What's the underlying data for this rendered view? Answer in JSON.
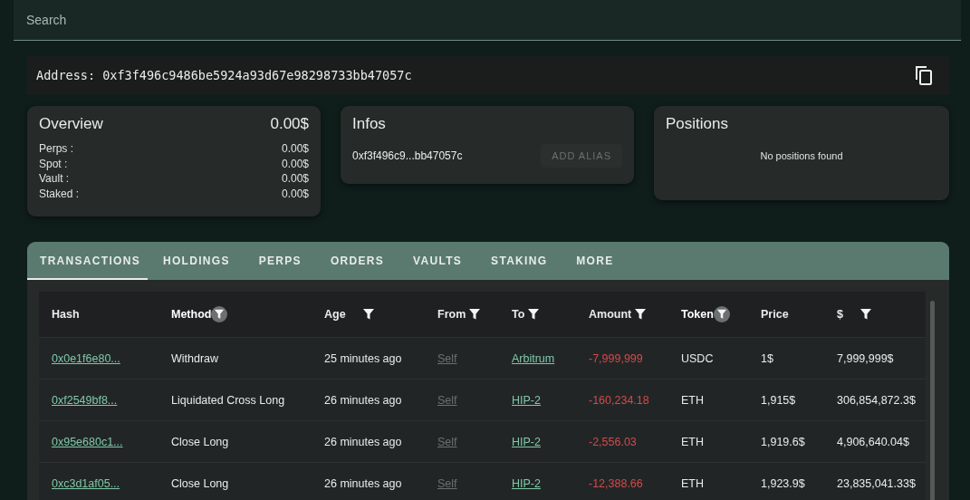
{
  "search": {
    "placeholder": "Search"
  },
  "address": {
    "label": "Address:",
    "value": "0xf3f496c9486be5924a93d67e98298733bb47057c"
  },
  "overview": {
    "title": "Overview",
    "total": "0.00$",
    "items": [
      {
        "label": "Perps :",
        "value": "0.00$"
      },
      {
        "label": "Spot :",
        "value": "0.00$"
      },
      {
        "label": "Vault :",
        "value": "0.00$"
      },
      {
        "label": "Staked :",
        "value": "0.00$"
      }
    ]
  },
  "infos": {
    "title": "Infos",
    "address": "0xf3f496c9...bb47057c",
    "button": {
      "label": "ADD ALIAS",
      "disabled": true
    }
  },
  "positions": {
    "title": "Positions",
    "empty": "No positions found"
  },
  "tabs": [
    {
      "label": "TRANSACTIONS",
      "selected": true
    },
    {
      "label": "HOLDINGS",
      "selected": false
    },
    {
      "label": "PERPS",
      "selected": false
    },
    {
      "label": "ORDERS",
      "selected": false
    },
    {
      "label": "VAULTS",
      "selected": false
    },
    {
      "label": "STAKING",
      "selected": false
    },
    {
      "label": "MORE",
      "selected": false
    }
  ],
  "table": {
    "columns": [
      {
        "label": "Hash",
        "filter": false
      },
      {
        "label": "Method",
        "filter": true,
        "filter_active": true
      },
      {
        "label": "Age",
        "filter": true,
        "filter_active": false
      },
      {
        "label": "From",
        "filter": true,
        "filter_active": false
      },
      {
        "label": "To",
        "filter": true,
        "filter_active": false
      },
      {
        "label": "Amount",
        "filter": true,
        "filter_active": false
      },
      {
        "label": "Token",
        "filter": true,
        "filter_active": true
      },
      {
        "label": "Price",
        "filter": false
      },
      {
        "label": "$",
        "filter": true,
        "filter_active": false
      }
    ],
    "rows": [
      {
        "hash": "0x0e1f6e80...",
        "method": "Withdraw",
        "age": "25 minutes ago",
        "from": "Self",
        "to": "Arbitrum",
        "amount": "-7,999,999",
        "negative": true,
        "token": "USDC",
        "price": "1$",
        "value": "7,999,999$"
      },
      {
        "hash": "0xf2549bf8...",
        "method": "Liquidated Cross Long",
        "age": "26 minutes ago",
        "from": "Self",
        "to": "HIP-2",
        "amount": "-160,234.18",
        "negative": true,
        "token": "ETH",
        "price": "1,915$",
        "value": "306,854,872.3$"
      },
      {
        "hash": "0x95e680c1...",
        "method": "Close Long",
        "age": "26 minutes ago",
        "from": "Self",
        "to": "HIP-2",
        "amount": "-2,556.03",
        "negative": true,
        "token": "ETH",
        "price": "1,919.6$",
        "value": "4,906,640.04$"
      },
      {
        "hash": "0xc3d1af05...",
        "method": "Close Long",
        "age": "26 minutes ago",
        "from": "Self",
        "to": "HIP-2",
        "amount": "-12,388.66",
        "negative": true,
        "token": "ETH",
        "price": "1,923.9$",
        "value": "23,835,041.33$"
      }
    ]
  }
}
